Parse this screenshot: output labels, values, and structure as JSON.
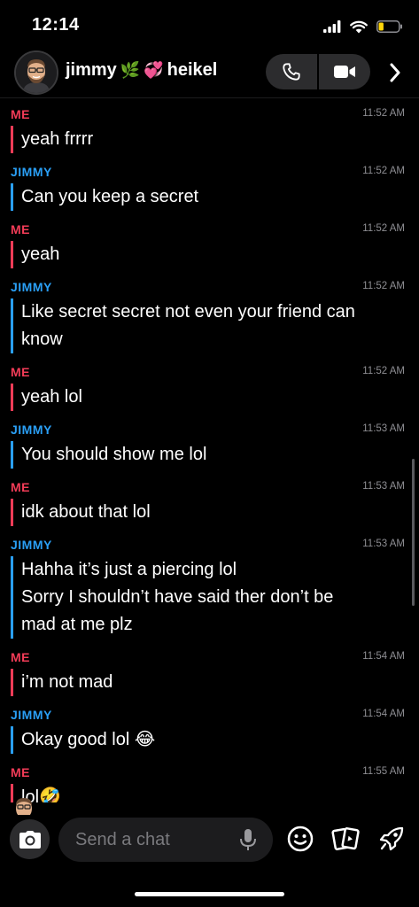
{
  "status_bar": {
    "time": "12:14",
    "battery_level": 0.25,
    "battery_color": "#ffd60a"
  },
  "header": {
    "title": "jimmy",
    "title_emoji_1": "🌿",
    "title_emoji_2": "💞",
    "title_suffix": "heikel",
    "avatar_icon": "bitmoji-avatar-icon",
    "call_icons": [
      "phone-icon",
      "video-camera-icon"
    ],
    "next_icon": "chevron-right-icon"
  },
  "colors": {
    "me": "#f23c57",
    "jimmy": "#2a9ff5",
    "background": "#000000"
  },
  "messages": [
    {
      "sender": "ME",
      "who": "me",
      "time": "11:52 AM",
      "text": "yeah frrrr"
    },
    {
      "sender": "JIMMY",
      "who": "jimmy",
      "time": "11:52 AM",
      "text": "Can you keep a secret"
    },
    {
      "sender": "ME",
      "who": "me",
      "time": "11:52 AM",
      "text": "yeah"
    },
    {
      "sender": "JIMMY",
      "who": "jimmy",
      "time": "11:52 AM",
      "text": "Like secret secret not even your friend can\nknow"
    },
    {
      "sender": "ME",
      "who": "me",
      "time": "11:52 AM",
      "text": "yeah lol"
    },
    {
      "sender": "JIMMY",
      "who": "jimmy",
      "time": "11:53 AM",
      "text": "You should show me lol"
    },
    {
      "sender": "ME",
      "who": "me",
      "time": "11:53 AM",
      "text": "idk about that lol"
    },
    {
      "sender": "JIMMY",
      "who": "jimmy",
      "time": "11:53 AM",
      "text": "Hahha it’s just a piercing lol\nSorry I shouldn’t have said ther don’t be\nmad at me plz"
    },
    {
      "sender": "ME",
      "who": "me",
      "time": "11:54 AM",
      "text": "i’m not mad"
    },
    {
      "sender": "JIMMY",
      "who": "jimmy",
      "time": "11:54 AM",
      "text": "Okay good lol 😂"
    },
    {
      "sender": "ME",
      "who": "me",
      "time": "11:55 AM",
      "text": "lol🤣"
    }
  ],
  "composer": {
    "placeholder": "Send a chat",
    "icons": [
      "camera-icon",
      "microphone-icon",
      "smiley-icon",
      "cards-icon",
      "rocket-icon"
    ]
  }
}
